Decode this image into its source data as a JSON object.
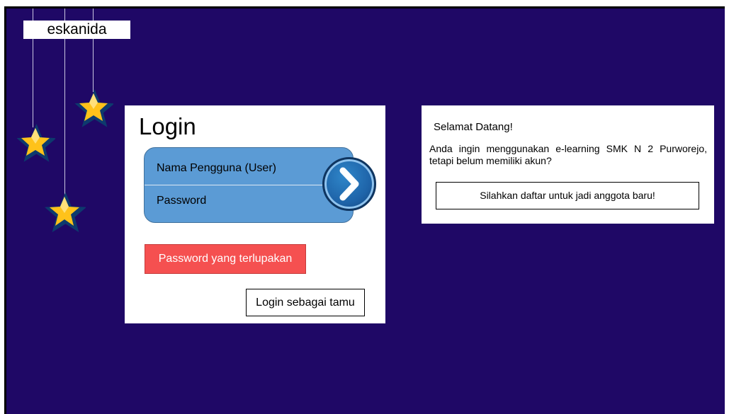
{
  "brand": {
    "name": "eskanida"
  },
  "colors": {
    "background": "#1f0866",
    "login_box": "#5b9bd5",
    "forgot_button": "#f55050",
    "star": "#ffc21a"
  },
  "decor": {
    "icon": "star-icon"
  },
  "login": {
    "title": "Login",
    "username_label": "Nama Pengguna (User)",
    "password_label": "Password",
    "submit_icon": "chevron-right-icon",
    "forgot_label": "Password yang terlupakan",
    "guest_label": "Login sebagai tamu"
  },
  "welcome": {
    "title": "Selamat Datang!",
    "message": "Anda ingin menggunakan e-learning SMK N 2 Purworejo, tetapi belum memiliki akun?",
    "register_label": "Silahkan daftar untuk jadi anggota baru!"
  }
}
